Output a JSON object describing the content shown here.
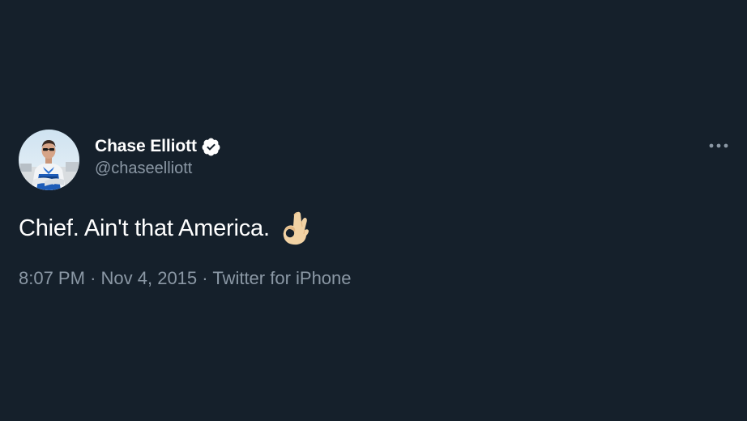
{
  "tweet": {
    "author": {
      "display_name": "Chase Elliott",
      "handle": "@chaseelliott",
      "verified": true,
      "verified_icon": "verified-badge-icon",
      "avatar": "profile-photo"
    },
    "text": "Chief. Ain't that America.",
    "emoji": "ok-hand-emoji",
    "meta": {
      "time": "8:07 PM",
      "separator": "·",
      "date": "Nov 4, 2015",
      "source": "Twitter for iPhone"
    },
    "more_icon": "more-options-icon"
  },
  "colors": {
    "background": "#15202b",
    "primary_text": "#ffffff",
    "secondary_text": "#8b98a5"
  }
}
